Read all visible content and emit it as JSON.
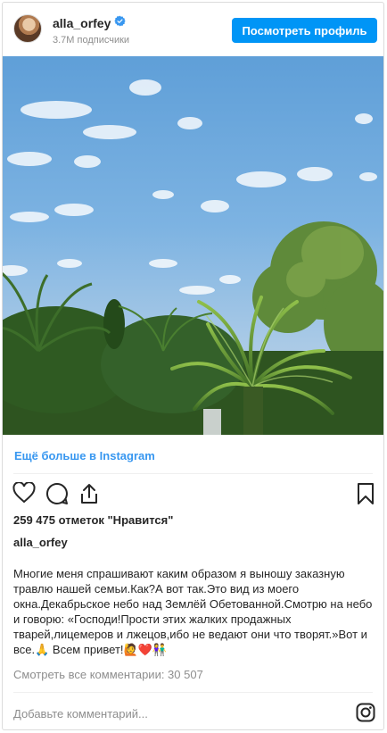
{
  "header": {
    "username": "alla_orfey",
    "followers": "3.7M подписчики",
    "view_profile_label": "Посмотреть профиль"
  },
  "photo": {
    "alt": "sky-and-palms-photo"
  },
  "more_link": "Ещё больше в Instagram",
  "likes": "259 475 отметок \"Нравится\"",
  "author": "alla_orfey",
  "caption": "Многие меня спрашивают каким образом я выношу заказную травлю нашей семьи.Как?А вот так.Это вид из моего окна.Декабрьское небо над Землёй Обетованной.Смотрю на небо и говорю: «Господи!Прости этих жалких продажных тварей,лицемеров и лжецов,ибо не ведают они что творят.»Вот и все.🙏 Всем привет!🙋❤️👫",
  "comments_link": "Смотреть все комментарии: 30 507",
  "comment_placeholder": "Добавьте комментарий...",
  "icons": {
    "verified": "verified-badge-icon",
    "like": "heart-icon",
    "comment": "comment-icon",
    "share": "share-icon",
    "save": "bookmark-icon",
    "instagram": "instagram-logo-icon"
  },
  "colors": {
    "accent": "#0095f6",
    "link": "#3897f0",
    "muted": "#8e8e8e",
    "text": "#262626"
  }
}
